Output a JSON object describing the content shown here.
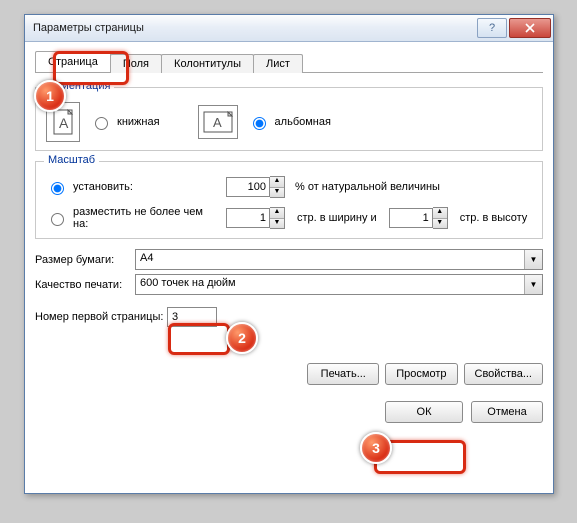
{
  "title": "Параметры страницы",
  "tabs": [
    "Страница",
    "Поля",
    "Колонтитулы",
    "Лист"
  ],
  "orient": {
    "legend": "Ориентация",
    "portrait": "книжная",
    "landscape": "альбомная"
  },
  "scale": {
    "legend": "Масштаб",
    "set_label": "установить:",
    "set_value": "100",
    "set_suffix": "% от натуральной величины",
    "fit_label": "разместить не более чем на:",
    "fit_w": "1",
    "fit_w_suffix": "стр. в ширину и",
    "fit_h": "1",
    "fit_h_suffix": "стр. в высоту"
  },
  "paper": {
    "label": "Размер бумаги:",
    "value": "A4"
  },
  "quality": {
    "label": "Качество печати:",
    "value": "600 точек на дюйм"
  },
  "firstpage": {
    "label": "Номер первой страницы:",
    "value": "3"
  },
  "buttons": {
    "print": "Печать...",
    "preview": "Просмотр",
    "props": "Свойства...",
    "ok": "ОК",
    "cancel": "Отмена"
  },
  "callouts": {
    "c1": "1",
    "c2": "2",
    "c3": "3"
  }
}
